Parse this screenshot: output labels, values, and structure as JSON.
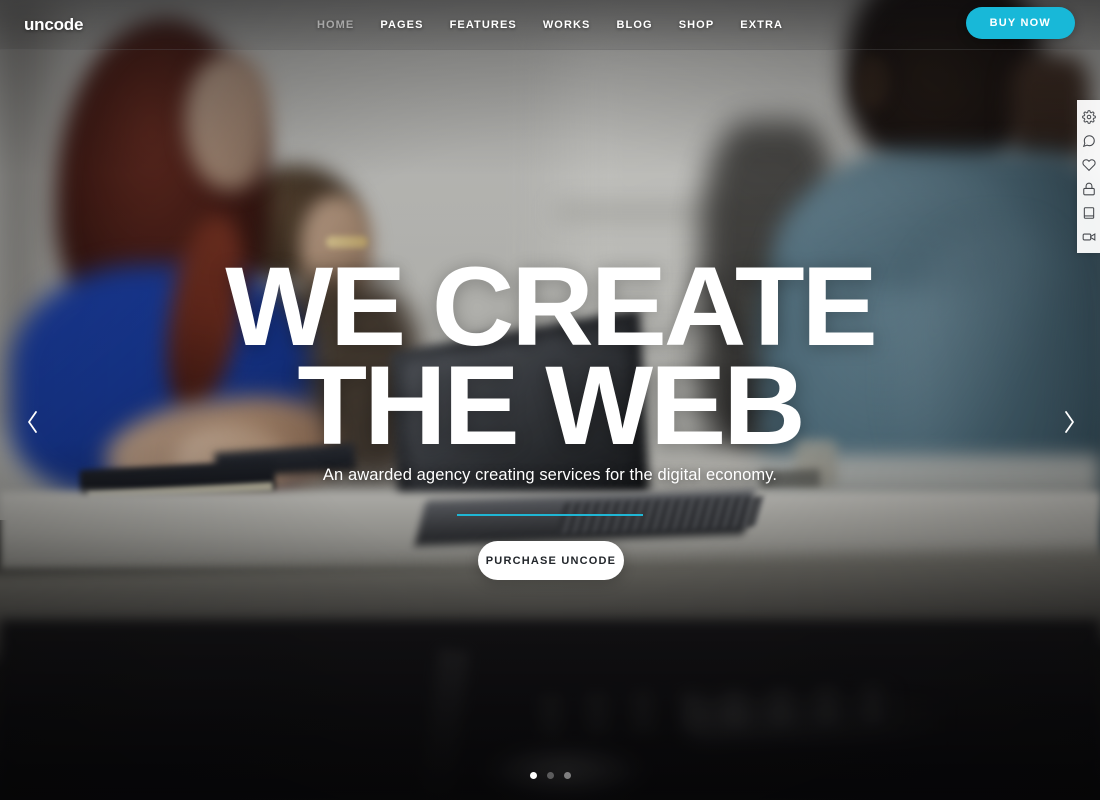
{
  "site": {
    "logo": "uncode"
  },
  "header": {
    "nav": [
      {
        "label": "HOME",
        "active": true
      },
      {
        "label": "PAGES",
        "active": false
      },
      {
        "label": "FEATURES",
        "active": false
      },
      {
        "label": "WORKS",
        "active": false
      },
      {
        "label": "BLOG",
        "active": false
      },
      {
        "label": "SHOP",
        "active": false
      },
      {
        "label": "EXTRA",
        "active": false
      }
    ],
    "cta_label": "BUY NOW",
    "cta_color": "#18b8d8"
  },
  "icon_rail": {
    "items": [
      {
        "icon": "gear-icon"
      },
      {
        "icon": "comment-icon"
      },
      {
        "icon": "heart-icon"
      },
      {
        "icon": "lock-icon"
      },
      {
        "icon": "book-icon"
      },
      {
        "icon": "video-camera-icon"
      }
    ]
  },
  "hero": {
    "headline_line1": "WE CREATE",
    "headline_line2": "THE WEB",
    "subtitle": "An awarded agency creating services for the digital economy.",
    "divider_color": "#1fb6d4",
    "button_label": "PURCHASE UNCODE",
    "prev_arrow": "‹",
    "next_arrow": "›"
  },
  "slider": {
    "dots": [
      {
        "state": "active"
      },
      {
        "state": "dim"
      },
      {
        "state": "inactive"
      }
    ]
  }
}
